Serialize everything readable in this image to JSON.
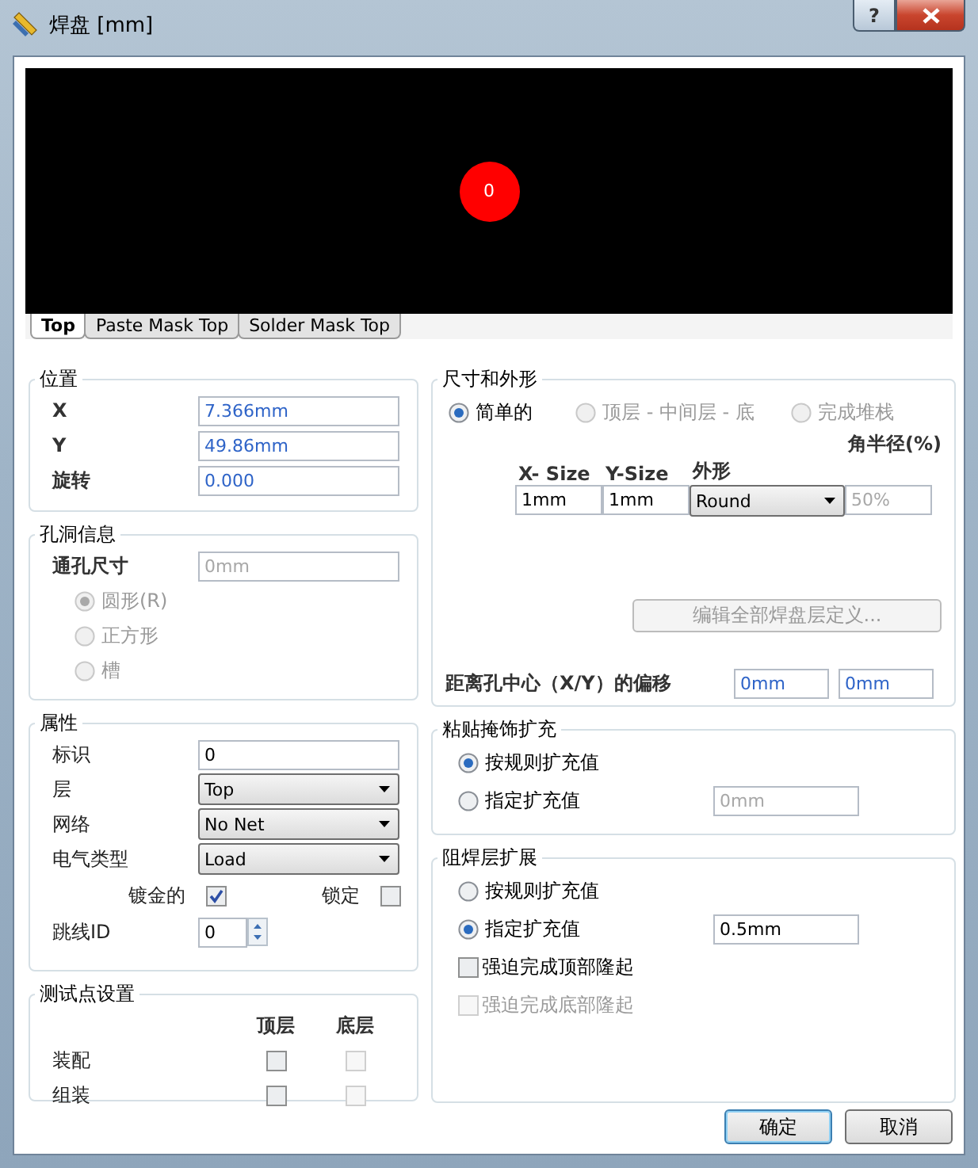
{
  "window": {
    "title": "焊盘 [mm]",
    "help_label": "?"
  },
  "preview": {
    "pad_label": "0"
  },
  "tabs": [
    {
      "label": "Top",
      "selected": true
    },
    {
      "label": "Paste Mask Top",
      "selected": false
    },
    {
      "label": "Solder Mask Top",
      "selected": false
    }
  ],
  "position": {
    "title": "位置",
    "fields": [
      {
        "label": "X",
        "value": "7.366mm"
      },
      {
        "label": "Y",
        "value": "49.86mm"
      },
      {
        "label": "旋转",
        "value": "0.000"
      }
    ]
  },
  "hole": {
    "title": "孔洞信息",
    "size_label": "通孔尺寸",
    "size_value": "0mm",
    "disabled": true,
    "shapes": [
      {
        "label": "圆形(R)",
        "selected": true
      },
      {
        "label": "正方形",
        "selected": false
      },
      {
        "label": "槽",
        "selected": false
      }
    ]
  },
  "properties": {
    "title": "属性",
    "rows": [
      {
        "kind": "text",
        "label": "标识",
        "value": "0"
      },
      {
        "kind": "select",
        "label": "层",
        "value": "Top"
      },
      {
        "kind": "select",
        "label": "网络",
        "value": "No Net"
      },
      {
        "kind": "select",
        "label": "电气类型",
        "value": "Load"
      }
    ],
    "plated": {
      "label": "镀金的",
      "checked": true
    },
    "locked": {
      "label": "锁定",
      "checked": false
    },
    "jumper": {
      "label": "跳线ID",
      "value": "0"
    }
  },
  "testpoint": {
    "title": "测试点设置",
    "columns": [
      "顶层",
      "底层"
    ],
    "rows": [
      {
        "label": "装配",
        "top": {
          "checked": false,
          "disabled": false
        },
        "bottom": {
          "checked": false,
          "disabled": true
        }
      },
      {
        "label": "组装",
        "top": {
          "checked": false,
          "disabled": false
        },
        "bottom": {
          "checked": false,
          "disabled": true
        }
      }
    ]
  },
  "size_shape": {
    "title": "尺寸和外形",
    "modes": [
      {
        "label": "简单的",
        "selected": true,
        "disabled": false
      },
      {
        "label": "顶层 - 中间层 - 底",
        "selected": false,
        "disabled": true
      },
      {
        "label": "完成堆栈",
        "selected": false,
        "disabled": true
      }
    ],
    "columns": [
      "X- Size",
      "Y-Size",
      "外形",
      "角半径(%)"
    ],
    "x_size": "1mm",
    "y_size": "1mm",
    "shape": "Round",
    "corner": "50%",
    "corner_disabled": true,
    "edit_button": {
      "label": "编辑全部焊盘层定义...",
      "disabled": true
    },
    "offset": {
      "label": "距离孔中心（X/Y）的偏移",
      "x": "0mm",
      "y": "0mm"
    }
  },
  "paste": {
    "title": "粘贴掩饰扩充",
    "options": [
      {
        "label": "按规则扩充值",
        "selected": true
      },
      {
        "label": "指定扩充值",
        "selected": false
      }
    ],
    "value": "0mm"
  },
  "solder": {
    "title": "阻焊层扩展",
    "options": [
      {
        "label": "按规则扩充值",
        "selected": false
      },
      {
        "label": "指定扩充值",
        "selected": true
      }
    ],
    "value": "0.5mm",
    "checks": [
      {
        "label": "强迫完成顶部隆起",
        "checked": false,
        "disabled": false
      },
      {
        "label": "强迫完成底部隆起",
        "checked": false,
        "disabled": true
      }
    ]
  },
  "buttons": [
    {
      "label": "确定",
      "kind": "default"
    },
    {
      "label": "取消",
      "kind": "normal"
    }
  ]
}
